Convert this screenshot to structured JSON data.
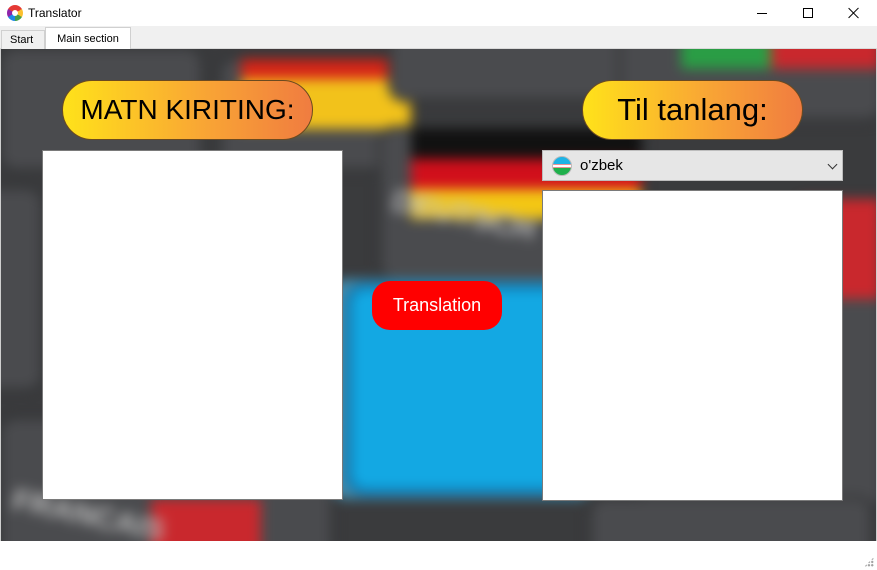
{
  "window": {
    "title": "Translator",
    "controls": [
      "minimize-icon",
      "maximize-icon",
      "close-icon"
    ]
  },
  "tabs": [
    {
      "label": "Start",
      "selected": false
    },
    {
      "label": "Main section",
      "selected": true
    }
  ],
  "main": {
    "input_heading": "MATN KIRITING:",
    "language_heading": "Til tanlang:",
    "input_text": "",
    "output_text": "",
    "language_select": {
      "selected": "o'zbek",
      "flag_icon": "uzbekistan-flag-icon"
    },
    "translate_button": "Translation"
  },
  "colors": {
    "pill_gradient": [
      "#ffe21a",
      "#f07c40"
    ],
    "translate_button": "#ff0000"
  }
}
